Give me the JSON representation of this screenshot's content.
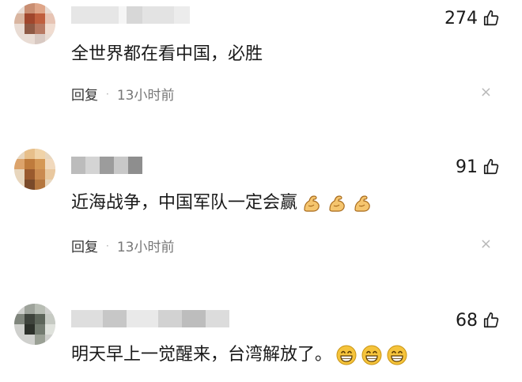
{
  "comments": [
    {
      "likes": "274",
      "text": "全世界都在看中国，必胜",
      "reply_label": "回复",
      "time": "13小时前",
      "close_glyph": "×"
    },
    {
      "likes": "91",
      "text": "近海战争，中国军队一定会赢",
      "emojis": [
        "flexed-biceps",
        "flexed-biceps",
        "flexed-biceps"
      ],
      "reply_label": "回复",
      "time": "13小时前",
      "close_glyph": "×"
    },
    {
      "likes": "68",
      "text": "明天早上一觉醒来，台湾解放了。",
      "emojis": [
        "grinning-face",
        "grinning-face",
        "grinning-face"
      ]
    }
  ],
  "separator": "·",
  "colors": {
    "text": "#1a1a1a",
    "meta": "#777777",
    "close": "#b9b9b9",
    "emoji": "#f5c33b"
  }
}
